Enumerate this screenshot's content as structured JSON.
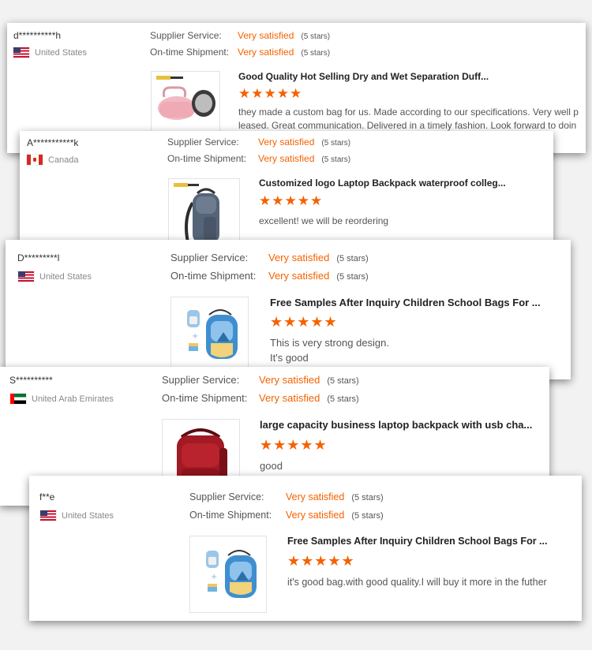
{
  "labels": {
    "supplier_service": "Supplier Service:",
    "ontime_shipment": "On-time Shipment:",
    "very_satisfied": "Very satisfied",
    "five_stars": "(5 stars)",
    "star_glyphs": "★★★★★"
  },
  "reviews": [
    {
      "user": "d**********h",
      "country": "United States",
      "flag": "us-flag-icon",
      "product_title": "Good Quality Hot Selling Dry and Wet Separation Duff...",
      "rating": 5,
      "comment": "they made a custom bag for us. Made according to our specifications. Very well pleased. Great communication. Delivered in a timely fashion. Look forward to doin"
    },
    {
      "user": "A***********k",
      "country": "Canada",
      "flag": "canada-flag-icon",
      "product_title": "Customized logo Laptop Backpack waterproof colleg...",
      "rating": 5,
      "comment": "excellent! we will be reordering"
    },
    {
      "user": "D*********l",
      "country": "United States",
      "flag": "us-flag-icon",
      "product_title": "Free Samples After Inquiry Children School Bags For ...",
      "rating": 5,
      "comment_lines": [
        "This is very strong design.",
        "It's good"
      ]
    },
    {
      "user": "S**********",
      "country": "United Arab Emirates",
      "flag": "uae-flag-icon",
      "product_title": "large capacity business laptop backpack with usb cha...",
      "rating": 5,
      "comment": "good"
    },
    {
      "user": "f**e",
      "country": "United States",
      "flag": "us-flag-icon",
      "product_title": "Free Samples After Inquiry Children School Bags For ...",
      "rating": 5,
      "comment": "it's good bag.with good quality.I will buy it more in the futher"
    }
  ],
  "colors": {
    "accent_orange": "#f46200",
    "label_gray": "#555555",
    "country_gray": "#888888"
  }
}
